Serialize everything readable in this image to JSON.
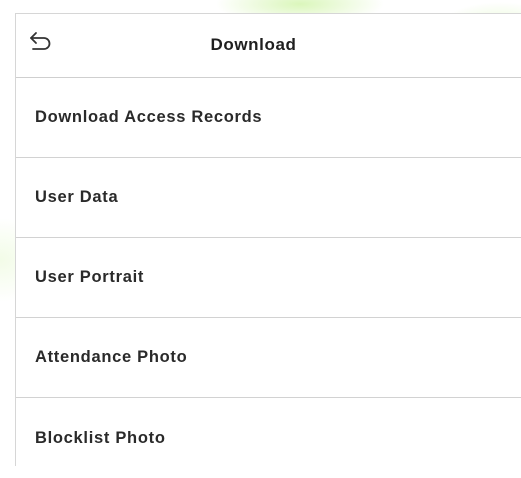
{
  "header": {
    "back_icon": "back-arrow-icon",
    "title": "Download"
  },
  "menu": {
    "items": [
      {
        "label": "Download Access Records"
      },
      {
        "label": "User Data"
      },
      {
        "label": "User Portrait"
      },
      {
        "label": "Attendance Photo"
      },
      {
        "label": "Blocklist Photo"
      }
    ]
  },
  "colors": {
    "background": "#ffffff",
    "text": "#222222",
    "divider": "#d2d2d2",
    "accent_glow": "#96e63c"
  }
}
